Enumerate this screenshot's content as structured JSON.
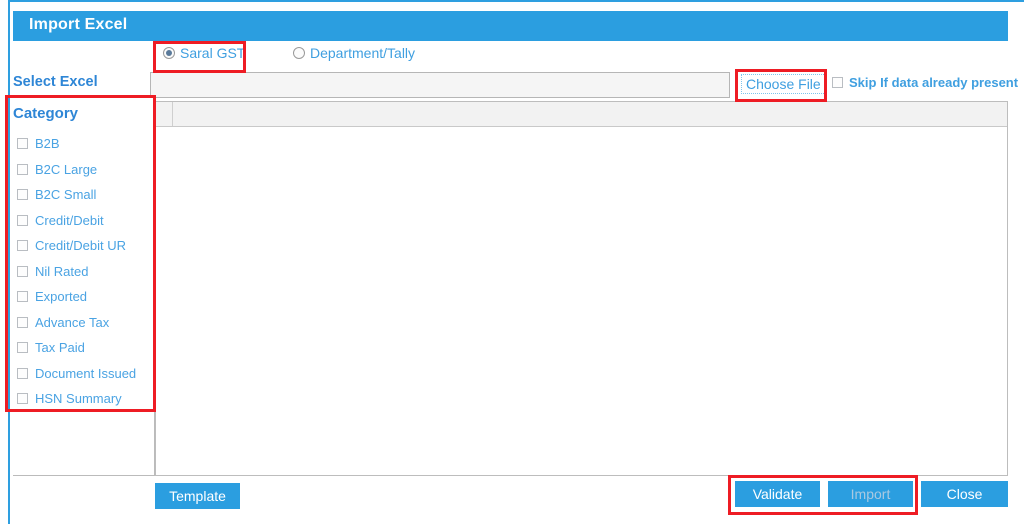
{
  "window": {
    "title": "Import Excel"
  },
  "source_options": {
    "selected": "Saral GST",
    "items": [
      {
        "label": "Saral GST",
        "checked": true
      },
      {
        "label": "Department/Tally",
        "checked": false
      }
    ]
  },
  "file_row": {
    "select_excel_label": "Select Excel",
    "file_path_value": "",
    "file_path_placeholder": "",
    "choose_file_label": "Choose File",
    "skip_checkbox_label": "Skip If data already present",
    "skip_checkbox_checked": false
  },
  "category": {
    "heading": "Category",
    "items": [
      {
        "label": "B2B",
        "checked": false
      },
      {
        "label": "B2C Large",
        "checked": false
      },
      {
        "label": "B2C Small",
        "checked": false
      },
      {
        "label": "Credit/Debit",
        "checked": false
      },
      {
        "label": "Credit/Debit UR",
        "checked": false
      },
      {
        "label": "Nil Rated",
        "checked": false
      },
      {
        "label": "Exported",
        "checked": false
      },
      {
        "label": "Advance Tax",
        "checked": false
      },
      {
        "label": "Tax Paid",
        "checked": false
      },
      {
        "label": "Document Issued",
        "checked": false
      },
      {
        "label": "HSN Summary",
        "checked": false
      }
    ]
  },
  "grid": {
    "columns": [],
    "rows": []
  },
  "buttons": {
    "template": "Template",
    "validate": "Validate",
    "import": "Import",
    "import_disabled": true,
    "close": "Close"
  },
  "colors": {
    "accent_blue": "#2b9ee0",
    "link_blue": "#4aa3e3",
    "heading_blue": "#2e86d6",
    "annotation_red": "#ee1c24",
    "disabled_text": "#a9c9e1"
  }
}
